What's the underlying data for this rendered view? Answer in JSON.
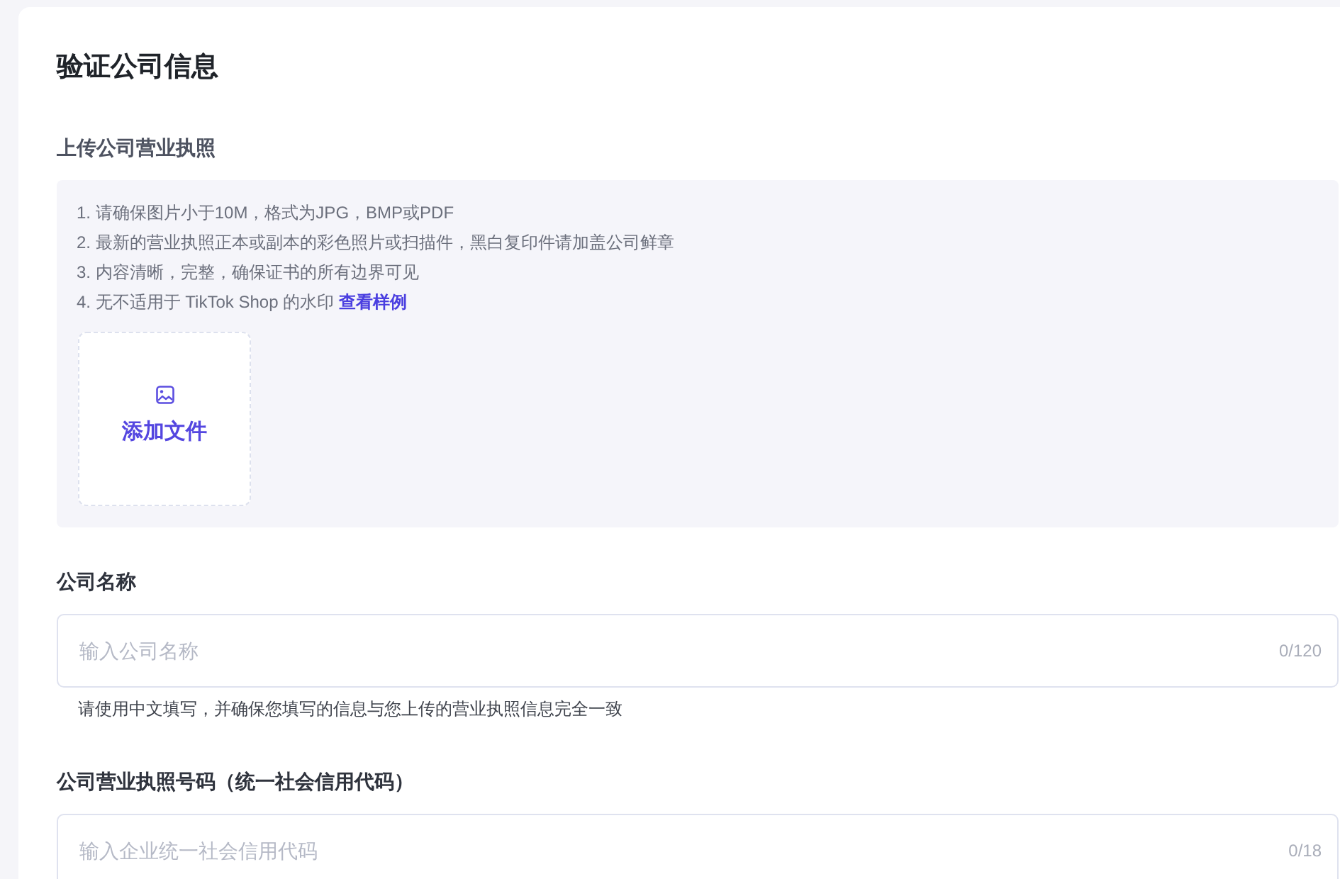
{
  "page": {
    "title": "验证公司信息"
  },
  "upload_section": {
    "label": "上传公司营业执照",
    "requirements": [
      "1. 请确保图片小于10M，格式为JPG，BMP或PDF",
      "2. 最新的营业执照正本或副本的彩色照片或扫描件，黑白复印件请加盖公司鲜章",
      "3. 内容清晰，完整，确保证书的所有边界可见",
      "4. 无不适用于 TikTok Shop 的水印"
    ],
    "sample_link": "查看样例",
    "upload_button": "添加文件"
  },
  "fields": [
    {
      "label": "公司名称",
      "placeholder": "输入公司名称",
      "counter": "0/120",
      "hint": "请使用中文填写，并确保您填写的信息与您上传的营业执照信息完全一致"
    },
    {
      "label": "公司营业执照号码（统一社会信用代码）",
      "placeholder": "输入企业统一社会信用代码",
      "counter": "0/18"
    }
  ]
}
